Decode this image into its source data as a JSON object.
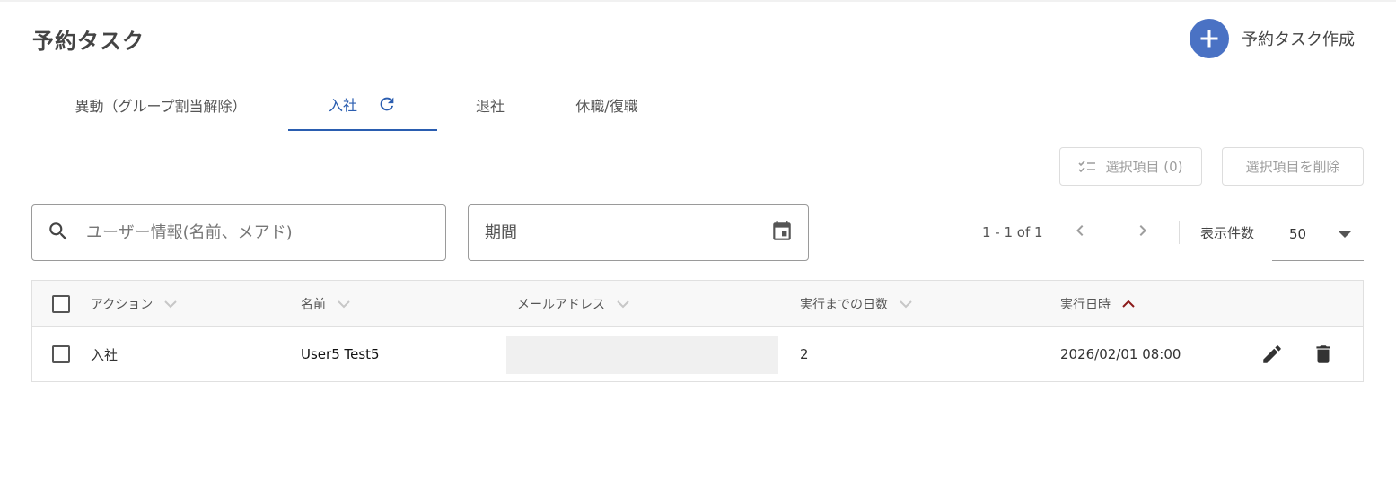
{
  "page": {
    "title": "予約タスク"
  },
  "header": {
    "create_label": "予約タスク作成"
  },
  "tabs": [
    {
      "label": "異動（グループ割当解除）"
    },
    {
      "label": "入社"
    },
    {
      "label": "退社"
    },
    {
      "label": "休職/復職"
    }
  ],
  "active_tab": "入社",
  "toolbar": {
    "selected_label": "選択項目 (0)",
    "delete_selected_label": "選択項目を削除"
  },
  "filters": {
    "search_placeholder": "ユーザー情報(名前、メアド)",
    "period_placeholder": "期間"
  },
  "pagination": {
    "range_text": "1 - 1 of 1",
    "per_page_label": "表示件数",
    "per_page_value": "50"
  },
  "table": {
    "columns": [
      "アクション",
      "名前",
      "メールアドレス",
      "実行までの日数",
      "実行日時"
    ],
    "sorted_column": "実行日時",
    "sort_direction": "ascending",
    "rows": [
      {
        "action": "入社",
        "name": "User5 Test5",
        "email": "",
        "days": "2",
        "datetime": "2026/02/01 08:00"
      }
    ]
  },
  "colors": {
    "primary": "#2a5db0",
    "create_button": "#4a72c4",
    "sort_active": "#8b1a1a"
  }
}
